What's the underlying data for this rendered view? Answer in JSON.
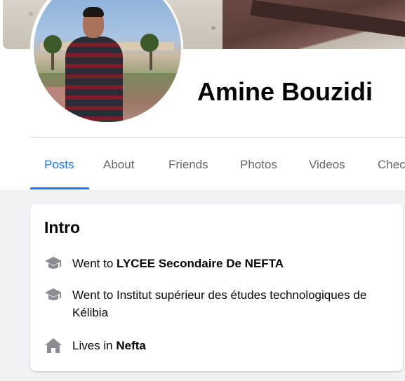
{
  "profile": {
    "name": "Amine Bouzidi"
  },
  "tabs": [
    {
      "label": "Posts",
      "active": true
    },
    {
      "label": "About",
      "active": false
    },
    {
      "label": "Friends",
      "active": false
    },
    {
      "label": "Photos",
      "active": false
    },
    {
      "label": "Videos",
      "active": false
    },
    {
      "label": "Chec",
      "active": false
    }
  ],
  "intro": {
    "title": "Intro",
    "items": [
      {
        "icon": "graduation-cap-icon",
        "prefix": "Went to ",
        "emphasis": "LYCEE Secondaire De NEFTA",
        "suffix": ""
      },
      {
        "icon": "graduation-cap-icon",
        "prefix": "Went to Institut supérieur des études technologiques de Kélibia",
        "emphasis": "",
        "suffix": ""
      },
      {
        "icon": "home-icon",
        "prefix": "Lives in ",
        "emphasis": "Nefta",
        "suffix": ""
      }
    ]
  },
  "colors": {
    "accent": "#1877f2",
    "page_bg": "#f0f2f5",
    "muted_text": "#65676b",
    "icon_gray": "#8a8d91"
  }
}
